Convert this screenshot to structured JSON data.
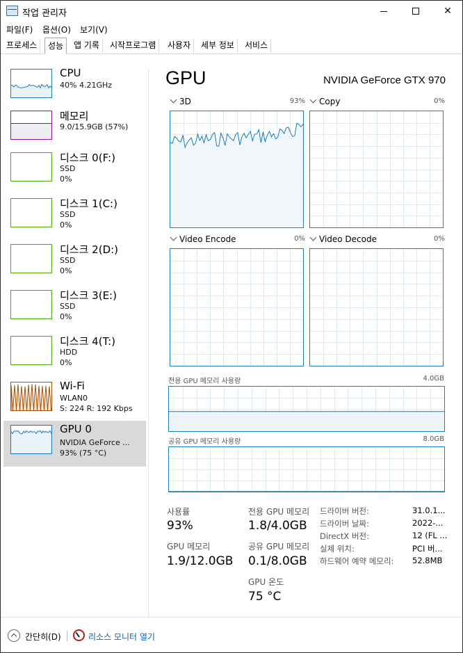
{
  "window": {
    "title": "작업 관리자"
  },
  "menu": [
    "파일(F)",
    "옵션(O)",
    "보기(V)"
  ],
  "tabs": [
    "프로세스",
    "성능",
    "앱 기록",
    "시작프로그램",
    "사용자",
    "세부 정보",
    "서비스"
  ],
  "active_tab": "성능",
  "sidebar": [
    {
      "name": "CPU",
      "line1": "40%  4.21GHz",
      "line2": "",
      "color": "#117dbb",
      "kind": "cpu"
    },
    {
      "name": "메모리",
      "line1": "9.0/15.9GB (57%)",
      "line2": "",
      "color": "#8b12ae",
      "kind": "mem"
    },
    {
      "name": "디스크 0(F:)",
      "line1": "SSD",
      "line2": "0%",
      "color": "#4da60c",
      "kind": "disk"
    },
    {
      "name": "디스크 1(C:)",
      "line1": "SSD",
      "line2": "0%",
      "color": "#4da60c",
      "kind": "disk"
    },
    {
      "name": "디스크 2(D:)",
      "line1": "SSD",
      "line2": "0%",
      "color": "#4da60c",
      "kind": "disk"
    },
    {
      "name": "디스크 3(E:)",
      "line1": "SSD",
      "line2": "0%",
      "color": "#4da60c",
      "kind": "disk"
    },
    {
      "name": "디스크 4(T:)",
      "line1": "HDD",
      "line2": "0%",
      "color": "#4da60c",
      "kind": "disk"
    },
    {
      "name": "Wi-Fi",
      "line1": "WLAN0",
      "line2": "S: 224  R: 192 Kbps",
      "color": "#a74f01",
      "kind": "wifi"
    },
    {
      "name": "GPU 0",
      "line1": "NVIDIA GeForce ...",
      "line2": "93% (75 °C)",
      "color": "#117dbb",
      "kind": "gpu"
    }
  ],
  "selected_index": 8,
  "main": {
    "title": "GPU",
    "gpu_name": "NVIDIA GeForce GTX 970",
    "engines": [
      {
        "label": "3D",
        "pct": "93%"
      },
      {
        "label": "Copy",
        "pct": "0%"
      },
      {
        "label": "Video Encode",
        "pct": "0%"
      },
      {
        "label": "Video Decode",
        "pct": "0%"
      }
    ],
    "dedicated_mem": {
      "label": "전용 GPU 메모리 사용량",
      "max": "4.0GB",
      "fraction": 0.45
    },
    "shared_mem": {
      "label": "공유 GPU 메모리 사용량",
      "max": "8.0GB",
      "fraction": 0.0125
    }
  },
  "stats": {
    "usage_label": "사용률",
    "usage_value": "93%",
    "gpu_mem_label": "GPU 메모리",
    "gpu_mem_value": "1.9/12.0GB",
    "ded_label": "전용 GPU 메모리",
    "ded_value": "1.8/4.0GB",
    "shared_label": "공유 GPU 메모리",
    "shared_value": "0.1/8.0GB",
    "temp_label": "GPU 온도",
    "temp_value": "75 °C"
  },
  "info": [
    {
      "key": "드라이버 버전:",
      "value": "31.0.1..."
    },
    {
      "key": "드라이버 날짜:",
      "value": "2022-..."
    },
    {
      "key": "DirectX 버전:",
      "value": "12 (FL ..."
    },
    {
      "key": "실제 위치:",
      "value": "PCI 버..."
    },
    {
      "key": "하드웨어 예약 메모리:",
      "value": "52.8MB"
    }
  ],
  "footer": {
    "collapse": "간단히(D)",
    "resource_monitor": "리소스 모니터 열기"
  }
}
